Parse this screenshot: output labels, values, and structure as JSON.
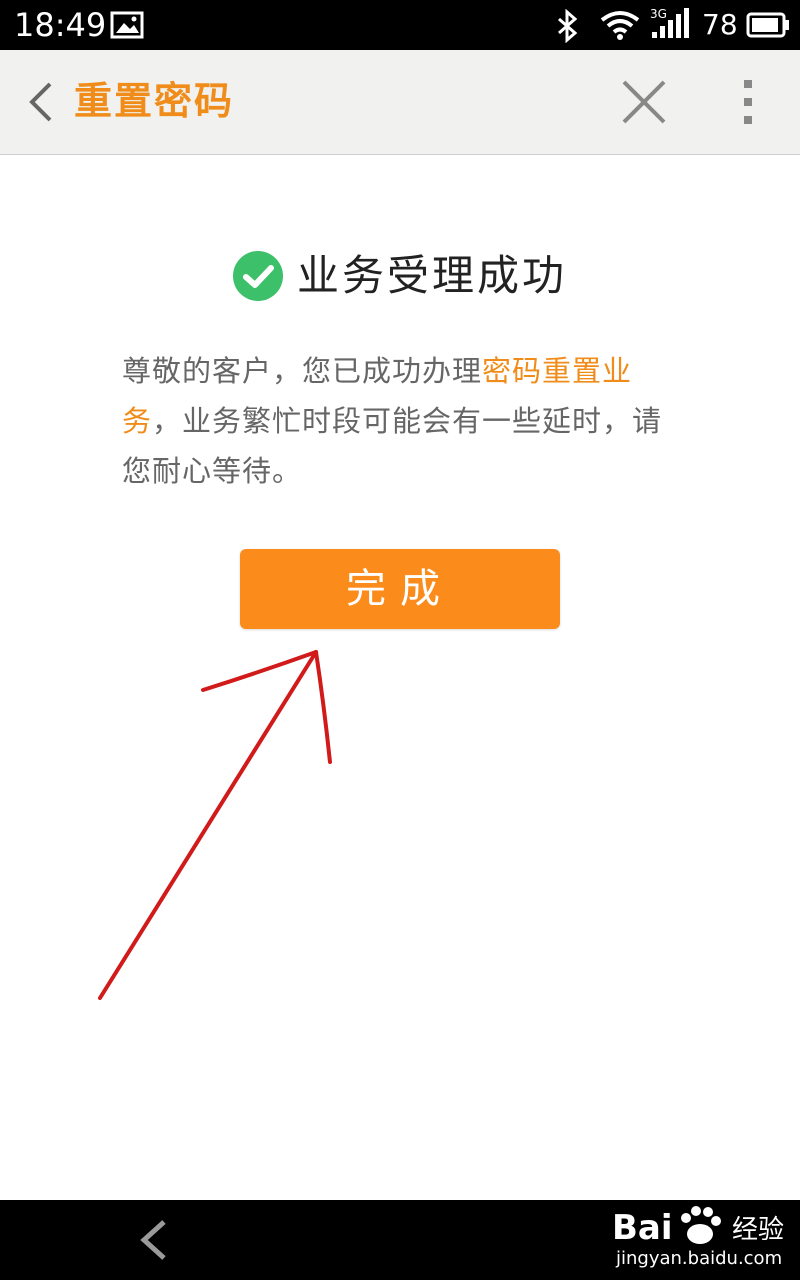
{
  "status_bar": {
    "time": "18:49",
    "network": "3G",
    "battery": "78"
  },
  "header": {
    "title": "重置密码"
  },
  "content": {
    "success_title": "业务受理成功",
    "message_before": "尊敬的客户，您已成功办理",
    "message_highlight": "密码重置业务",
    "message_after": "，业务繁忙时段可能会有一些延时，请您耐心等待。",
    "done_label": "完成"
  },
  "watermark": {
    "brand": "Bai",
    "product": "经验",
    "url": "jingyan.baidu.com"
  },
  "colors": {
    "accent": "#f08c1a",
    "button": "#fb8c1c",
    "success": "#3cc06a",
    "annotation": "#d11a1a"
  }
}
